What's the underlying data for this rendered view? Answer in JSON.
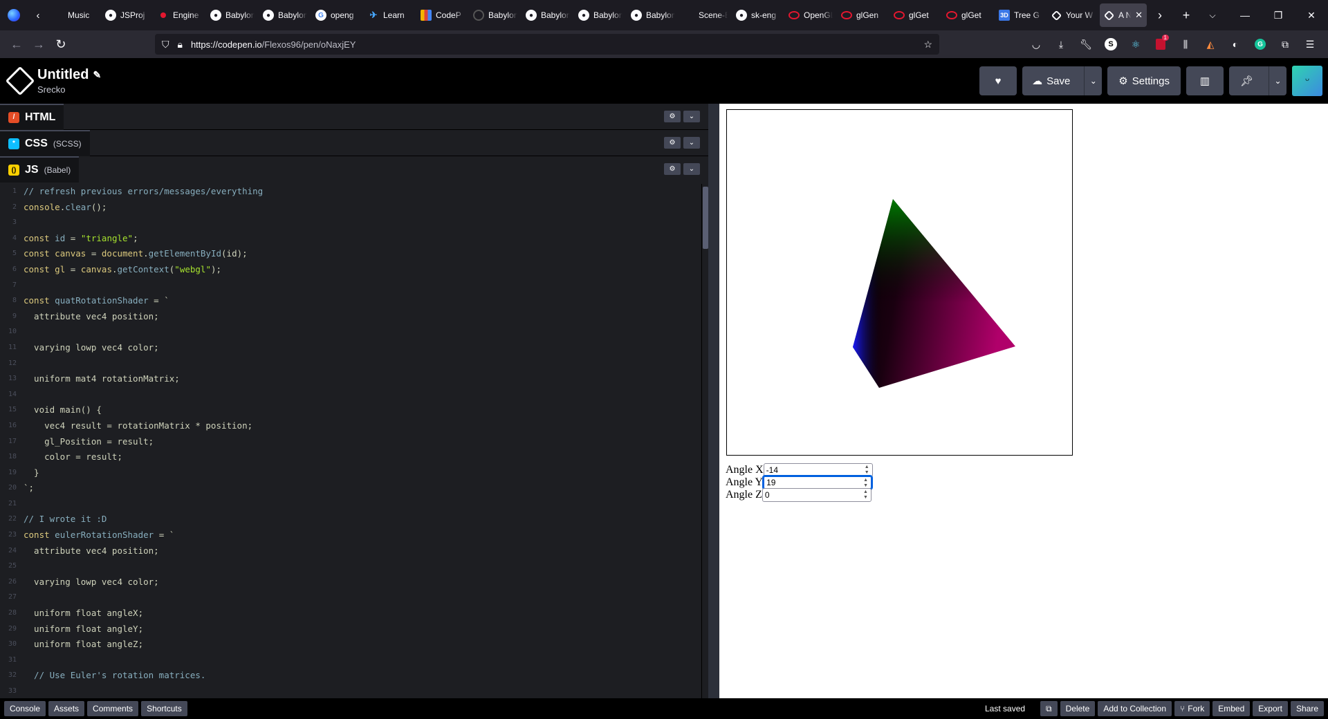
{
  "tabs": [
    {
      "label": "Music",
      "icon": "blank"
    },
    {
      "label": "JSProj",
      "icon": "github"
    },
    {
      "label": "Engine",
      "icon": "red-dot"
    },
    {
      "label": "Babylon",
      "icon": "github"
    },
    {
      "label": "Babylon",
      "icon": "github"
    },
    {
      "label": "openg",
      "icon": "google"
    },
    {
      "label": "Learn",
      "icon": "plane"
    },
    {
      "label": "CodeP",
      "icon": "bar-chart"
    },
    {
      "label": "Babylon",
      "icon": "circle"
    },
    {
      "label": "Babylon",
      "icon": "github"
    },
    {
      "label": "Babylon",
      "icon": "github"
    },
    {
      "label": "Babylon",
      "icon": "github"
    },
    {
      "label": "Scene-Engine",
      "icon": "blank"
    },
    {
      "label": "sk-eng",
      "icon": "github"
    },
    {
      "label": "OpenGL",
      "icon": "opengl"
    },
    {
      "label": "glGen",
      "icon": "opengl"
    },
    {
      "label": "glGet",
      "icon": "opengl"
    },
    {
      "label": "glGet",
      "icon": "opengl"
    },
    {
      "label": "Tree G",
      "icon": "3d"
    },
    {
      "label": "Your W",
      "icon": "codepen"
    },
    {
      "label": "A N",
      "icon": "codepen",
      "active": true
    }
  ],
  "browser": {
    "url_host": "https://codepen.io",
    "url_path": "/Flexos96/pen/oNaxjEY",
    "ext_badge": "1"
  },
  "pen": {
    "title": "Untitled",
    "author": "Srecko"
  },
  "header_buttons": {
    "save": "Save",
    "settings": "Settings"
  },
  "editors": {
    "html": {
      "name": "HTML",
      "sub": ""
    },
    "css": {
      "name": "CSS",
      "sub": "(SCSS)"
    },
    "js": {
      "name": "JS",
      "sub": "(Babel)"
    }
  },
  "code_lines": [
    "// refresh previous errors/messages/everything",
    "console.clear();",
    "",
    "const id = \"triangle\";",
    "const canvas = document.getElementById(id);",
    "const gl = canvas.getContext(\"webgl\");",
    "",
    "const quatRotationShader = `",
    "  attribute vec4 position;",
    "",
    "  varying lowp vec4 color;",
    "",
    "  uniform mat4 rotationMatrix;",
    "",
    "  void main() {",
    "    vec4 result = rotationMatrix * position;",
    "    gl_Position = result;",
    "    color = result;",
    "  }",
    "`;",
    "",
    "// I wrote it :D",
    "const eulerRotationShader = `",
    "  attribute vec4 position;",
    "",
    "  varying lowp vec4 color;",
    "",
    "  uniform float angleX;",
    "  uniform float angleY;",
    "  uniform float angleZ;",
    "",
    "  // Use Euler's rotation matrices.",
    ""
  ],
  "preview": {
    "angles": [
      {
        "label": "Angle X",
        "value": "-14"
      },
      {
        "label": "Angle Y",
        "value": "19",
        "focused": true
      },
      {
        "label": "Angle Z",
        "value": "0"
      }
    ]
  },
  "footer": {
    "left": [
      "Console",
      "Assets",
      "Comments",
      "Shortcuts"
    ],
    "last_saved": "Last saved",
    "delete": "Delete",
    "add_to_collection": "Add to Collection",
    "fork": "Fork",
    "embed": "Embed",
    "export": "Export",
    "share": "Share"
  }
}
